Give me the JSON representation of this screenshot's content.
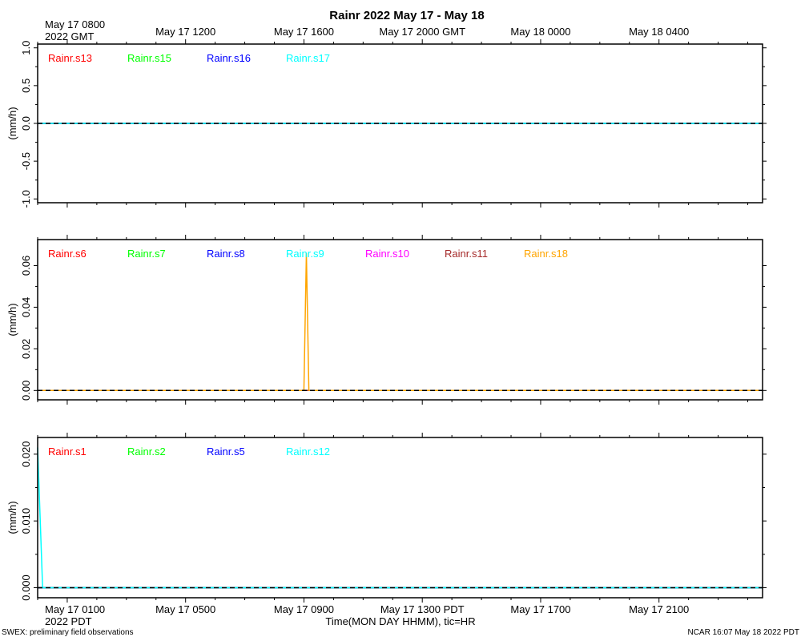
{
  "header": {
    "title": "Rainr 2022 May 17 - May 18",
    "start_label_line1": "May 17 0800",
    "start_label_line2": "2022 GMT"
  },
  "footer": {
    "start_label_line1": "May 17 0100",
    "start_label_line2": "2022 PDT",
    "xlabel": "Time(MON DAY HHMM), tic=HR",
    "left_note": "SWEX: preliminary field observations",
    "right_note": "NCAR 16:07 May 18 2022 PDT"
  },
  "chart_data": {
    "type": "line",
    "x_unit": "hours since May 17 0100 PDT",
    "xlim": [
      -1,
      23.5
    ],
    "top_axis_ticks": [
      {
        "x": 4,
        "label": "May 17 1200"
      },
      {
        "x": 8,
        "label": "May 17 1600"
      },
      {
        "x": 12,
        "label": "May 17 2000 GMT"
      },
      {
        "x": 16,
        "label": "May 18 0000"
      },
      {
        "x": 20,
        "label": "May 18 0400"
      }
    ],
    "bottom_axis_ticks": [
      {
        "x": 4,
        "label": "May 17 0500"
      },
      {
        "x": 8,
        "label": "May 17 0900"
      },
      {
        "x": 12,
        "label": "May 17 1300 PDT"
      },
      {
        "x": 16,
        "label": "May 17 1700"
      },
      {
        "x": 20,
        "label": "May 17 2100"
      }
    ],
    "panels": [
      {
        "ylabel": "(mm/h)",
        "ylim": [
          -1.05,
          1.05
        ],
        "yticks": [
          -1.0,
          -0.5,
          0.0,
          0.5,
          1.0
        ],
        "ytick_labels": [
          "-1.0",
          "-0.5",
          "0.0",
          "0.5",
          "1.0"
        ],
        "series": [
          {
            "name": "Rainr.s13",
            "color": "#ff0000",
            "x": [
              -1,
              23.5
            ],
            "y": [
              0,
              0
            ]
          },
          {
            "name": "Rainr.s15",
            "color": "#00ff00",
            "x": [
              -1,
              23.5
            ],
            "y": [
              0,
              0
            ]
          },
          {
            "name": "Rainr.s16",
            "color": "#0000ff",
            "x": [
              -1,
              23.5
            ],
            "y": [
              0,
              0
            ]
          },
          {
            "name": "Rainr.s17",
            "color": "#00ffff",
            "x": [
              -1,
              23.5
            ],
            "y": [
              0,
              0
            ]
          }
        ]
      },
      {
        "ylabel": "(mm/h)",
        "ylim": [
          -0.0045,
          0.0725
        ],
        "yticks": [
          0.0,
          0.02,
          0.04,
          0.06
        ],
        "ytick_labels": [
          "0.00",
          "0.02",
          "0.04",
          "0.06"
        ],
        "series": [
          {
            "name": "Rainr.s6",
            "color": "#ff0000",
            "x": [
              -1,
              23.5
            ],
            "y": [
              0,
              0
            ]
          },
          {
            "name": "Rainr.s7",
            "color": "#00ff00",
            "x": [
              -1,
              23.5
            ],
            "y": [
              0,
              0
            ]
          },
          {
            "name": "Rainr.s8",
            "color": "#0000ff",
            "x": [
              -1,
              23.5
            ],
            "y": [
              0,
              0
            ]
          },
          {
            "name": "Rainr.s9",
            "color": "#00ffff",
            "x": [
              -1,
              23.5
            ],
            "y": [
              0,
              0
            ]
          },
          {
            "name": "Rainr.s10",
            "color": "#ff00ff",
            "x": [
              -1,
              23.5
            ],
            "y": [
              0,
              0
            ]
          },
          {
            "name": "Rainr.s11",
            "color": "#a52a2a",
            "x": [
              -1,
              23.5
            ],
            "y": [
              0,
              0
            ]
          },
          {
            "name": "Rainr.s18",
            "color": "#ffa500",
            "x": [
              -1,
              8.0,
              8.083,
              8.167,
              23.5
            ],
            "y": [
              0,
              0,
              0.066,
              0,
              0
            ]
          }
        ]
      },
      {
        "ylabel": "(mm/h)",
        "ylim": [
          -0.0015,
          0.0225
        ],
        "yticks": [
          0.0,
          0.01,
          0.02
        ],
        "ytick_labels": [
          "0.000",
          "0.010",
          "0.020"
        ],
        "series": [
          {
            "name": "Rainr.s1",
            "color": "#ff0000",
            "x": [
              -1,
              23.5
            ],
            "y": [
              0,
              0
            ]
          },
          {
            "name": "Rainr.s2",
            "color": "#00ff00",
            "x": [
              -1,
              23.5
            ],
            "y": [
              0,
              0
            ]
          },
          {
            "name": "Rainr.s5",
            "color": "#0000ff",
            "x": [
              -1,
              23.5
            ],
            "y": [
              0,
              0
            ]
          },
          {
            "name": "Rainr.s12",
            "color": "#00ffff",
            "x": [
              -1,
              -0.833,
              23.5
            ],
            "y": [
              0.021,
              0,
              0
            ]
          }
        ]
      }
    ]
  }
}
